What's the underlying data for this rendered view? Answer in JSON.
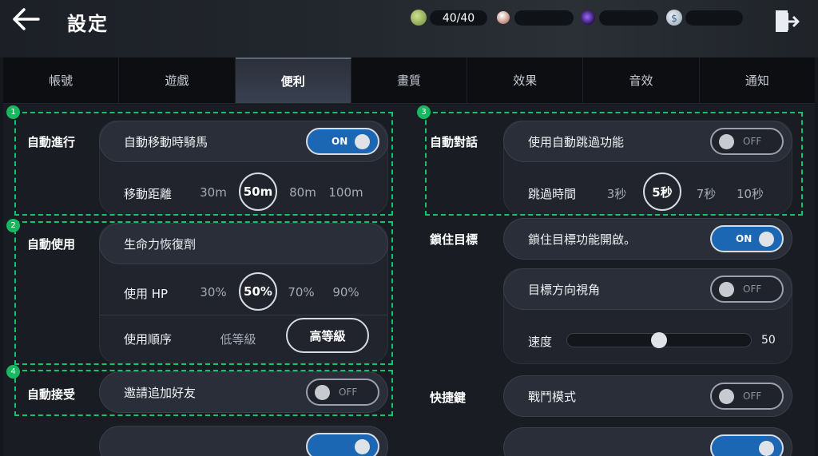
{
  "header": {
    "title": "設定",
    "stamina": "40/40"
  },
  "tabs": [
    "帳號",
    "遊戲",
    "便利",
    "畫質",
    "效果",
    "音效",
    "通知"
  ],
  "active_tab": 2,
  "badges": [
    "1",
    "2",
    "3",
    "4"
  ],
  "auto_proceed": {
    "label": "自動進行",
    "mount_toggle_label": "自動移動時騎馬",
    "mount_toggle_state": "ON",
    "distance_label": "移動距離",
    "distance_options": [
      "30m",
      "50m",
      "80m",
      "100m"
    ],
    "distance_selected": "50m"
  },
  "auto_use": {
    "label": "自動使用",
    "item_name": "生命力恢復劑",
    "hp_label": "使用 HP",
    "hp_options": [
      "30%",
      "50%",
      "70%",
      "90%"
    ],
    "hp_selected": "50%",
    "order_label": "使用順序",
    "order_options": [
      "低等級",
      "高等級"
    ],
    "order_selected": "高等級"
  },
  "auto_accept": {
    "label": "自動接受",
    "friend_toggle_label": "邀請追加好友",
    "friend_toggle_state": "OFF"
  },
  "auto_dialog": {
    "label": "自動對話",
    "skip_toggle_label": "使用自動跳過功能",
    "skip_toggle_state": "OFF",
    "skip_time_label": "跳過時間",
    "skip_time_options": [
      "3秒",
      "5秒",
      "7秒",
      "10秒"
    ],
    "skip_time_selected": "5秒"
  },
  "lock_target": {
    "label": "鎖住目標",
    "lock_toggle_label": "鎖住目標功能開啟。",
    "lock_toggle_state": "ON",
    "direction_toggle_label": "目標方向視角",
    "direction_toggle_state": "OFF",
    "speed_label": "速度",
    "speed_value": "50"
  },
  "hotkey": {
    "label": "快捷鍵",
    "battle_toggle_label": "戰鬥模式",
    "battle_toggle_state": "OFF"
  },
  "colors": {
    "accent": "#1b67b4",
    "annotation": "#13c46a",
    "background": "#1a1c23"
  },
  "icons": {
    "back": "back-arrow-icon",
    "exit": "exit-door-icon",
    "stamina": "stamina-icon",
    "pearl": "pearl-icon",
    "orb": "purple-orb-icon",
    "silver": "silver-coin-icon"
  }
}
